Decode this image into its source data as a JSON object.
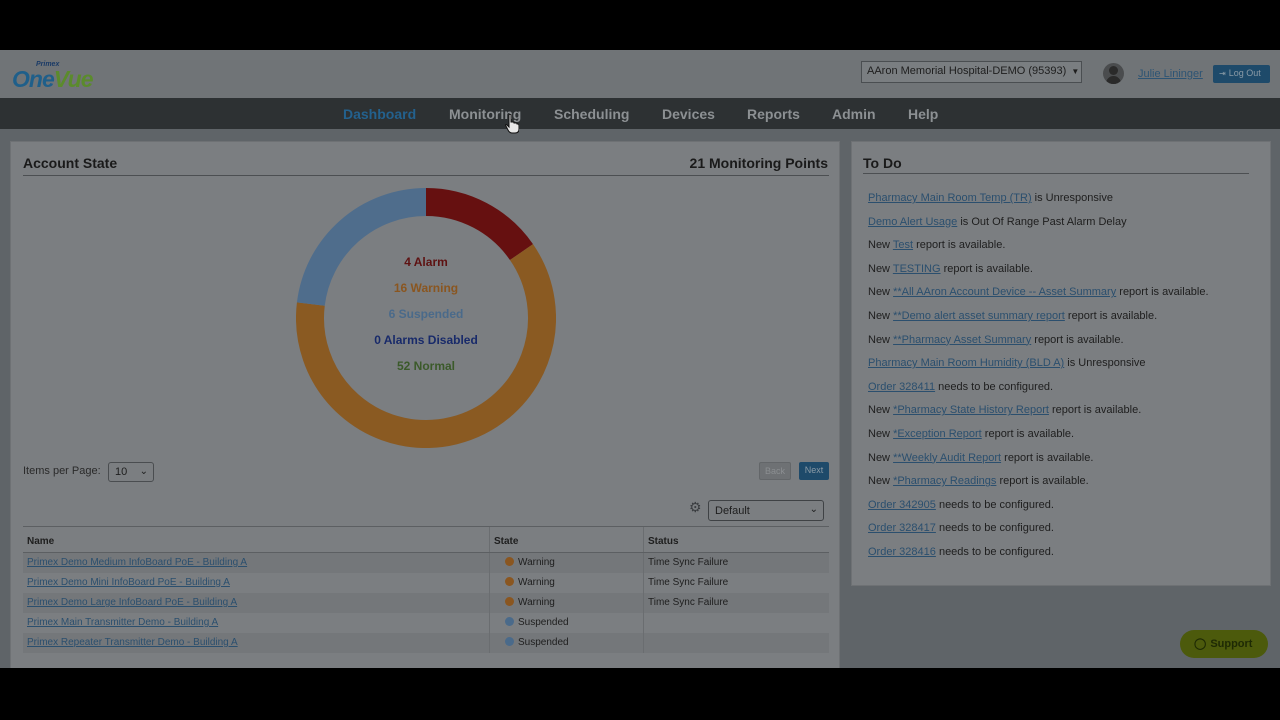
{
  "header": {
    "logo_brand": "Primex",
    "logo_o": "O",
    "logo_ne": "ne",
    "logo_vue": "Vue",
    "account_select": "AAron Memorial Hospital-DEMO (95393)",
    "user_name": "Julie Lininger",
    "logout_label": "Log Out"
  },
  "nav": {
    "items": [
      "Dashboard",
      "Monitoring",
      "Scheduling",
      "Devices",
      "Reports",
      "Admin",
      "Help"
    ],
    "active": "Dashboard"
  },
  "account_state": {
    "title": "Account State",
    "points_label": "21 Monitoring Points",
    "legend": [
      {
        "label": "4 Alarm",
        "color": "#5e1212"
      },
      {
        "label": "16 Warning",
        "color": "#8a5620"
      },
      {
        "label": "6 Suspended",
        "color": "#4a6a8a"
      },
      {
        "label": "0 Alarms Disabled",
        "color": "#182a6a"
      },
      {
        "label": "52 Normal",
        "color": "#3b5a2a"
      }
    ],
    "donut": [
      {
        "value": 4,
        "color": "#661010"
      },
      {
        "value": 16,
        "color": "#8a5a22"
      },
      {
        "value": 0,
        "color": "#1e2a6a"
      },
      {
        "value": 6,
        "color": "#4f6d8c"
      }
    ]
  },
  "pager": {
    "items_per_page_label": "Items per Page:",
    "items_per_page_value": "10",
    "back_label": "Back",
    "next_label": "Next"
  },
  "view_select": "Default",
  "table": {
    "headers": [
      "Name",
      "State",
      "Status"
    ],
    "rows": [
      {
        "name": "Primex Demo Medium InfoBoard PoE - Building A",
        "state": "Warning",
        "state_color": "#8a5620",
        "status": "Time Sync Failure"
      },
      {
        "name": "Primex Demo Mini InfoBoard PoE - Building A",
        "state": "Warning",
        "state_color": "#8a5620",
        "status": "Time Sync Failure"
      },
      {
        "name": "Primex Demo Large InfoBoard PoE - Building A",
        "state": "Warning",
        "state_color": "#8a5620",
        "status": "Time Sync Failure"
      },
      {
        "name": "Primex Main Transmitter Demo - Building A",
        "state": "Suspended",
        "state_color": "#4a6a8a",
        "status": ""
      },
      {
        "name": "Primex Repeater Transmitter Demo - Building A",
        "state": "Suspended",
        "state_color": "#4a6a8a",
        "status": ""
      }
    ]
  },
  "todo": {
    "title": "To Do",
    "items": [
      {
        "pre": "",
        "link": "Pharmacy Main Room Temp (TR)",
        "post": " is Unresponsive"
      },
      {
        "pre": "",
        "link": "Demo Alert Usage",
        "post": " is Out Of Range Past Alarm Delay"
      },
      {
        "pre": "New ",
        "link": "Test",
        "post": " report is available."
      },
      {
        "pre": "New ",
        "link": "TESTING",
        "post": " report is available."
      },
      {
        "pre": "New ",
        "link": "**All AAron Account Device -- Asset Summary",
        "post": " report is available."
      },
      {
        "pre": "New ",
        "link": "**Demo alert asset summary report",
        "post": " report is available."
      },
      {
        "pre": "New ",
        "link": "**Pharmacy Asset Summary",
        "post": " report is available."
      },
      {
        "pre": "",
        "link": "Pharmacy Main Room Humidity (BLD A)",
        "post": " is Unresponsive"
      },
      {
        "pre": "",
        "link": "Order 328411",
        "post": " needs to be configured."
      },
      {
        "pre": "New ",
        "link": "*Pharmacy State History Report",
        "post": " report is available."
      },
      {
        "pre": "New ",
        "link": "*Exception Report",
        "post": " report is available."
      },
      {
        "pre": "New ",
        "link": "**Weekly Audit Report",
        "post": " report is available."
      },
      {
        "pre": "New ",
        "link": "*Pharmacy Readings",
        "post": " report is available."
      },
      {
        "pre": "",
        "link": "Order 342905",
        "post": " needs to be configured."
      },
      {
        "pre": "",
        "link": "Order 328417",
        "post": " needs to be configured."
      },
      {
        "pre": "",
        "link": "Order 328416",
        "post": " needs to be configured."
      }
    ]
  },
  "support_label": "Support"
}
